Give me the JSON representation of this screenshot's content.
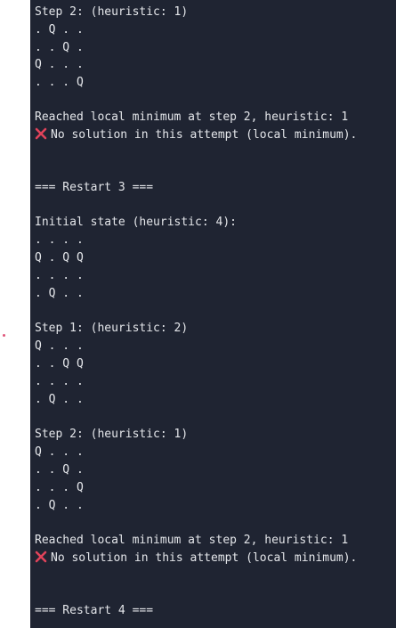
{
  "output": {
    "lines": [
      "Step 2: (heuristic: 1)",
      ". Q . .",
      ". . Q .",
      "Q . . .",
      ". . . Q",
      "",
      "Reached local minimum at step 2, heuristic: 1",
      "No solution in this attempt (local minimum).",
      "",
      "",
      "=== Restart 3 ===",
      "",
      "Initial state (heuristic: 4):",
      ". . . .",
      "Q . Q Q",
      ". . . .",
      ". Q . .",
      "",
      "Step 1: (heuristic: 2)",
      "Q . . .",
      ". . Q Q",
      ". . . .",
      ". Q . .",
      "",
      "Step 2: (heuristic: 1)",
      "Q . . .",
      ". . Q .",
      ". . . Q",
      ". Q . .",
      "",
      "Reached local minimum at step 2, heuristic: 1",
      "No solution in this attempt (local minimum).",
      "",
      "",
      "=== Restart 4 ==="
    ],
    "error_icon": "cross-mark-icon",
    "error_icon_color": "#e0435a"
  },
  "colors": {
    "terminal_bg": "#1f2432",
    "text": "#e4e6ea",
    "gutter_marker": "#e0567a"
  }
}
